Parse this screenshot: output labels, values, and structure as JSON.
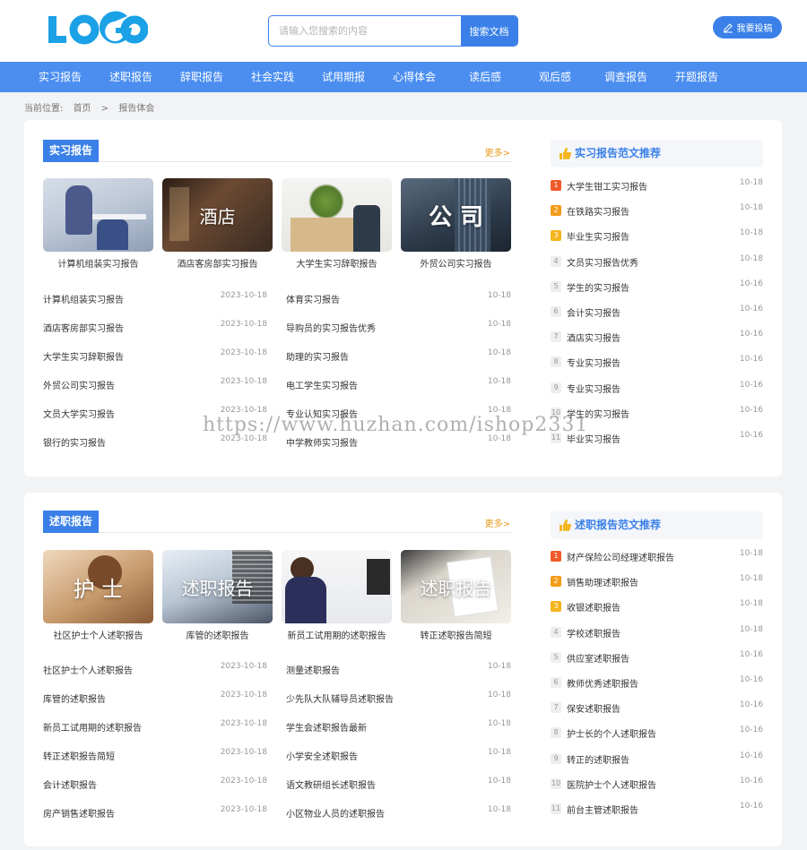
{
  "header": {
    "logo_text": "LOGO",
    "search_placeholder": "请输入您搜索的内容",
    "search_button": "搜索文档",
    "submit_label": "我要投稿"
  },
  "nav": [
    "实习报告",
    "述职报告",
    "辞职报告",
    "社会实践",
    "试用期报",
    "心得体会",
    "读后感",
    "观后感",
    "调查报告",
    "开题报告"
  ],
  "breadcrumb": {
    "label": "当前位置:",
    "home": "首页",
    "sep": ">",
    "current": "报告体会"
  },
  "watermark": "https://www.huzhan.com/ishop2331",
  "sections": [
    {
      "title": "实习报告",
      "more": "更多>",
      "thumbs": [
        {
          "caption": "计算机组装实习报告",
          "overlay": ""
        },
        {
          "caption": "酒店客房部实习报告",
          "overlay": "酒店"
        },
        {
          "caption": "大学生实习辞职报告",
          "overlay": ""
        },
        {
          "caption": "外贸公司实习报告",
          "overlay": "公 司"
        }
      ],
      "left_list": [
        {
          "title": "计算机组装实习报告",
          "date": "2023-10-18"
        },
        {
          "title": "酒店客房部实习报告",
          "date": "2023-10-18"
        },
        {
          "title": "大学生实习辞职报告",
          "date": "2023-10-18"
        },
        {
          "title": "外贸公司实习报告",
          "date": "2023-10-18"
        },
        {
          "title": "文员大学实习报告",
          "date": "2023-10-18"
        },
        {
          "title": "银行的实习报告",
          "date": "2023-10-18"
        }
      ],
      "right_list": [
        {
          "title": "体育实习报告",
          "date": "10-18"
        },
        {
          "title": "导购员的实习报告优秀",
          "date": "10-18"
        },
        {
          "title": "助理的实习报告",
          "date": "10-18"
        },
        {
          "title": "电工学生实习报告",
          "date": "10-18"
        },
        {
          "title": "专业认知实习报告",
          "date": "10-18"
        },
        {
          "title": "中学教师实习报告",
          "date": "10-18"
        }
      ],
      "side_title": "实习报告范文推荐",
      "side_list": [
        {
          "num": "1",
          "title": "大学生钳工实习报告",
          "date": "10-18"
        },
        {
          "num": "2",
          "title": "在铁路实习报告",
          "date": "10-18"
        },
        {
          "num": "3",
          "title": "毕业生实习报告",
          "date": "10-18"
        },
        {
          "num": "4",
          "title": "文员实习报告优秀",
          "date": "10-18"
        },
        {
          "num": "5",
          "title": "学生的实习报告",
          "date": "10-16"
        },
        {
          "num": "6",
          "title": "会计实习报告",
          "date": "10-16"
        },
        {
          "num": "7",
          "title": "酒店实习报告",
          "date": "10-16"
        },
        {
          "num": "8",
          "title": "专业实习报告",
          "date": "10-16"
        },
        {
          "num": "9",
          "title": "专业实习报告",
          "date": "10-16"
        },
        {
          "num": "10",
          "title": "学生的实习报告",
          "date": "10-16"
        },
        {
          "num": "11",
          "title": "毕业实习报告",
          "date": "10-16"
        }
      ]
    },
    {
      "title": "述职报告",
      "more": "更多>",
      "thumbs": [
        {
          "caption": "社区护士个人述职报告",
          "overlay": "护 士"
        },
        {
          "caption": "库管的述职报告",
          "overlay": "述职报告"
        },
        {
          "caption": "新员工试用期的述职报告",
          "overlay": ""
        },
        {
          "caption": "转正述职报告简短",
          "overlay": "述职报告"
        }
      ],
      "left_list": [
        {
          "title": "社区护士个人述职报告",
          "date": "2023-10-18"
        },
        {
          "title": "库管的述职报告",
          "date": "2023-10-18"
        },
        {
          "title": "新员工试用期的述职报告",
          "date": "2023-10-18"
        },
        {
          "title": "转正述职报告简短",
          "date": "2023-10-18"
        },
        {
          "title": "会计述职报告",
          "date": "2023-10-18"
        },
        {
          "title": "房产销售述职报告",
          "date": "2023-10-18"
        }
      ],
      "right_list": [
        {
          "title": "测量述职报告",
          "date": "10-18"
        },
        {
          "title": "少先队大队辅导员述职报告",
          "date": "10-18"
        },
        {
          "title": "学生会述职报告最新",
          "date": "10-18"
        },
        {
          "title": "小学安全述职报告",
          "date": "10-18"
        },
        {
          "title": "语文教研组长述职报告",
          "date": "10-18"
        },
        {
          "title": "小区物业人员的述职报告",
          "date": "10-18"
        }
      ],
      "side_title": "述职报告范文推荐",
      "side_list": [
        {
          "num": "1",
          "title": "财产保险公司经理述职报告",
          "date": "10-18"
        },
        {
          "num": "2",
          "title": "销售助理述职报告",
          "date": "10-18"
        },
        {
          "num": "3",
          "title": "收银述职报告",
          "date": "10-18"
        },
        {
          "num": "4",
          "title": "学校述职报告",
          "date": "10-18"
        },
        {
          "num": "5",
          "title": "供应室述职报告",
          "date": "10-16"
        },
        {
          "num": "6",
          "title": "教师优秀述职报告",
          "date": "10-16"
        },
        {
          "num": "7",
          "title": "保安述职报告",
          "date": "10-16"
        },
        {
          "num": "8",
          "title": "护士长的个人述职报告",
          "date": "10-16"
        },
        {
          "num": "9",
          "title": "转正的述职报告",
          "date": "10-16"
        },
        {
          "num": "10",
          "title": "医院护士个人述职报告",
          "date": "10-16"
        },
        {
          "num": "11",
          "title": "前台主管述职报告",
          "date": "10-16"
        }
      ]
    }
  ]
}
